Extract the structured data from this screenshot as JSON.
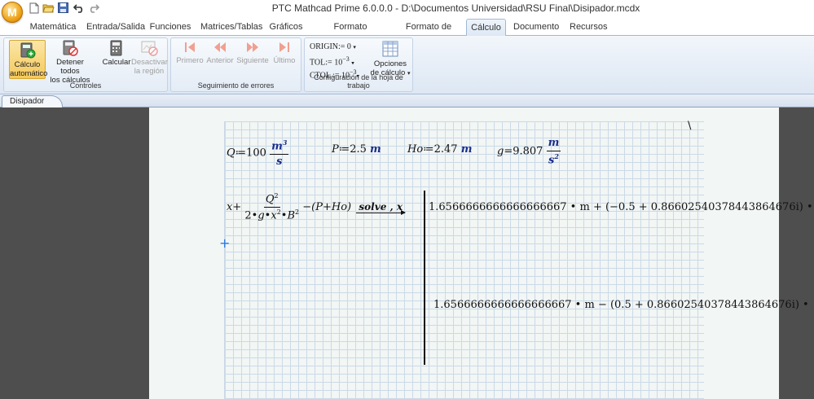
{
  "window": {
    "title": "PTC Mathcad Prime 6.0.0.0 - D:\\Documentos Universidad\\RSU Final\\Disipador.mcdx",
    "logo": "M"
  },
  "quick_access": [
    "new-file-icon",
    "open-folder-icon",
    "save-icon",
    "undo-icon",
    "redo-icon"
  ],
  "tabs": [
    {
      "label": "Matemática"
    },
    {
      "label": "Entrada/Salida"
    },
    {
      "label": "Funciones"
    },
    {
      "label": "Matrices/Tablas"
    },
    {
      "label": "Gráficos"
    },
    {
      "label": "Formato matemático"
    },
    {
      "label": "Formato de texto"
    },
    {
      "label": "Cálculo",
      "active": true
    },
    {
      "label": "Documento"
    },
    {
      "label": "Recursos"
    }
  ],
  "ribbon": {
    "controles": {
      "label": "Controles",
      "auto_calc": [
        "Cálculo",
        "automático"
      ],
      "stop_all": [
        "Detener todos",
        "los cálculos"
      ],
      "calcular": "Calcular",
      "desactivar": [
        "Desactivar",
        "la región"
      ]
    },
    "errores": {
      "label": "Seguimiento de errores",
      "primero": "Primero",
      "anterior": "Anterior",
      "siguiente": "Siguiente",
      "ultimo": "Último"
    },
    "config": {
      "label": "Configuración de la hoja de trabajo",
      "origin_label": "ORIGIN:=",
      "origin_value": "0",
      "tol_label": "TOL:=",
      "tol_value": "10",
      "tol_exp": "−3",
      "ctol_label": "CTOL :=",
      "ctol_value": "10",
      "ctol_exp": "−3",
      "opciones": [
        "Opciones",
        "de cálculo"
      ]
    }
  },
  "document_tab": "Disipador",
  "worksheet": {
    "q_def": {
      "name": "Q",
      "assign": "≔",
      "value": "100",
      "unit_num": "m",
      "unit_num_exp": "3",
      "unit_den": "s"
    },
    "p_def": {
      "name": "P",
      "assign": "≔",
      "value": "2.5",
      "unit": "m"
    },
    "ho_def": {
      "name": "Ho",
      "assign": "≔",
      "value": "2.47",
      "unit": "m"
    },
    "g_def": {
      "name": "g",
      "assign": "=",
      "value": "9.807",
      "unit_num": "m",
      "unit_den": "s",
      "unit_den_exp": "2"
    },
    "eq": {
      "lhs_x": "x",
      "plus": "+",
      "num": "Q",
      "num_exp": "2",
      "den_a": "2",
      "den_g": "g",
      "den_x": "x",
      "den_x_exp": "2",
      "den_b": "B",
      "den_b_exp": "2",
      "minus_part": "−(P+Ho)",
      "keyword": "solve , x",
      "result1": "1.6566666666666666667 • m + (−0.5 + 0.86602540378443864676i) •",
      "result2": "1.6566666666666666667 • m − (0.5 + 0.86602540378443864676i) •"
    },
    "corner_mark": "\\",
    "cursor": "+"
  }
}
